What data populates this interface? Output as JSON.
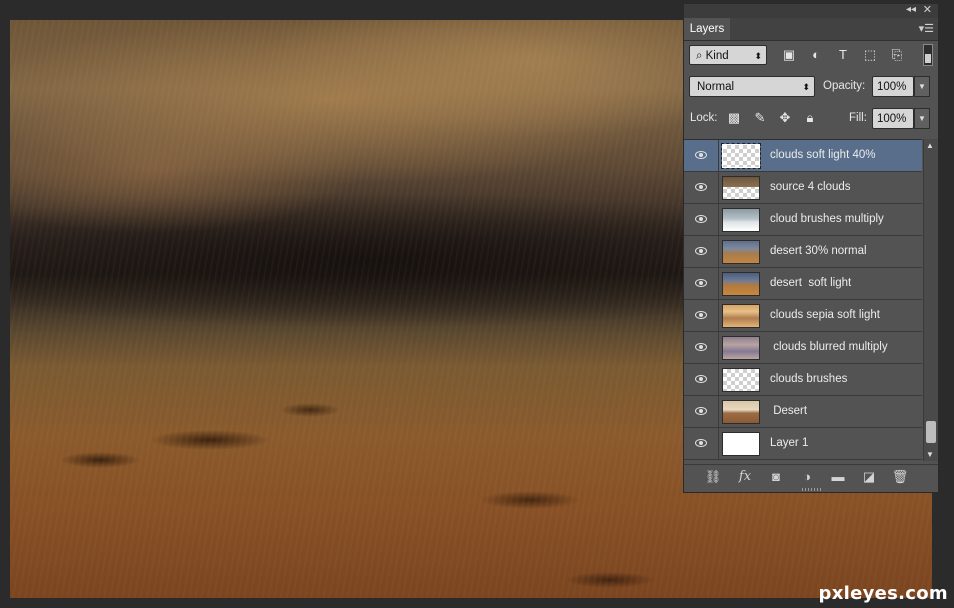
{
  "window": {
    "collapse_icon": "double-chevron-left-icon",
    "close_icon": "close-icon"
  },
  "layers_panel": {
    "tab_label": "Layers",
    "menu_icon": "panel-menu-icon",
    "filter": {
      "kind_label": "Kind",
      "search_icon": "search-icon",
      "filter_icons": [
        "image-filter-icon",
        "adjustment-filter-icon",
        "type-filter-icon",
        "shape-filter-icon",
        "smart-object-filter-icon"
      ]
    },
    "blend_mode": "Normal",
    "opacity_label": "Opacity:",
    "opacity_value": "100%",
    "lock_label": "Lock:",
    "lock_icons": [
      "lock-transparent-icon",
      "lock-paint-icon",
      "lock-position-icon",
      "lock-all-icon"
    ],
    "fill_label": "Fill:",
    "fill_value": "100%",
    "layers": [
      {
        "name": "clouds soft light 40%",
        "thumb": "checker",
        "selected": true,
        "visible": true
      },
      {
        "name": "source 4 clouds",
        "thumb": "src4",
        "selected": false,
        "visible": true
      },
      {
        "name": "cloud brushes multiply",
        "thumb": "brushmul",
        "selected": false,
        "visible": true
      },
      {
        "name": "desert 30% normal",
        "thumb": "desert30",
        "selected": false,
        "visible": true
      },
      {
        "name": "desert  soft light",
        "thumb": "desertsl",
        "selected": false,
        "visible": true
      },
      {
        "name": "clouds sepia soft light",
        "thumb": "sepia",
        "selected": false,
        "visible": true
      },
      {
        "name": " clouds blurred multiply",
        "thumb": "blur",
        "selected": false,
        "visible": true
      },
      {
        "name": "clouds brushes",
        "thumb": "checker",
        "selected": false,
        "visible": true
      },
      {
        "name": " Desert",
        "thumb": "desert",
        "selected": false,
        "visible": true
      },
      {
        "name": "Layer 1",
        "thumb": "white",
        "selected": false,
        "visible": true
      }
    ],
    "footer_icons": [
      "link-layers-icon",
      "fx-icon",
      "layer-mask-icon",
      "adjustment-layer-icon",
      "new-group-icon",
      "new-layer-icon",
      "trash-icon"
    ],
    "footer_fx_label": "fx"
  },
  "watermark": "pxleyes.com",
  "colors": {
    "panel_bg": "#535353",
    "selected_row": "#586e8a",
    "app_bg": "#2b2b2b"
  }
}
